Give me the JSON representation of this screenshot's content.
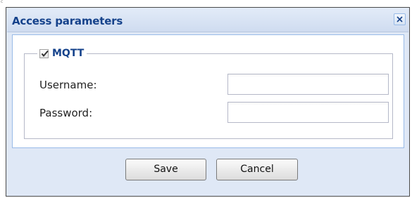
{
  "corner_mark": "c",
  "dialog": {
    "title": "Access parameters",
    "close_icon": "close-icon"
  },
  "fieldset": {
    "legend": "MQTT",
    "checkbox_checked": true,
    "fields": [
      {
        "label": "Username:",
        "value": "",
        "placeholder": ""
      },
      {
        "label": "Password:",
        "value": "",
        "placeholder": ""
      }
    ]
  },
  "buttons": {
    "save": "Save",
    "cancel": "Cancel"
  },
  "colors": {
    "title": "#15428b",
    "dialog_bg": "#dfe8f6",
    "border": "#99bbe8"
  }
}
